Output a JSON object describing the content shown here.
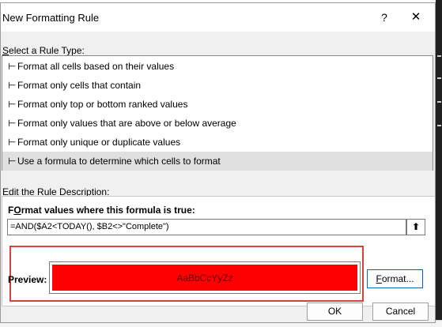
{
  "dialog": {
    "title": "New Formatting Rule",
    "help_glyph": "?",
    "close_glyph": "✕"
  },
  "rule_type": {
    "label_first": "S",
    "label_rest": "elect a Rule Type:",
    "bullet_glyph": "⊢",
    "selected_index": 5,
    "items": [
      {
        "label": "Format all cells based on their values"
      },
      {
        "label": "Format only cells that contain"
      },
      {
        "label": "Format only top or bottom ranked values"
      },
      {
        "label": "Format only values that are above or below average"
      },
      {
        "label": "Format only unique or duplicate values"
      },
      {
        "label": "Use a formula to determine which cells to format"
      }
    ]
  },
  "description": {
    "label_first": "E",
    "label_rest": "dit the Rule Description:",
    "formula_label_first": "O",
    "formula_label_pre": "F",
    "formula_label_rest": "rmat values where this formula is true:",
    "formula_value": "=AND($A2<TODAY(), $B2<>\"Complete\")",
    "collapse_glyph": "⬆"
  },
  "preview": {
    "label": "Preview:",
    "sample_text": "AaBbCcYyZz",
    "fill_color": "#ff0000",
    "highlight_color": "#d9413d"
  },
  "buttons": {
    "format_first": "F",
    "format_rest": "ormat...",
    "ok": "OK",
    "cancel": "Cancel"
  }
}
